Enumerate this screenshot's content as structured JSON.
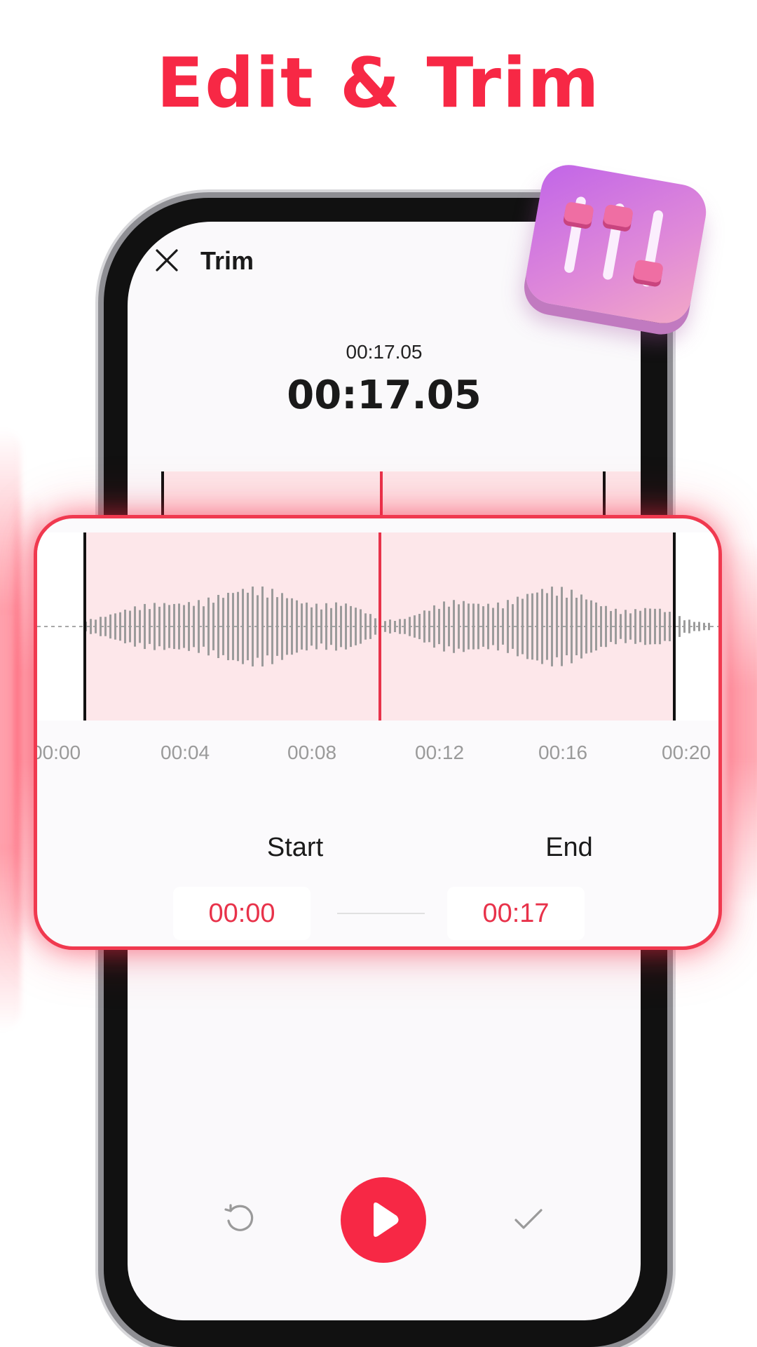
{
  "headline": "Edit & Trim",
  "screen": {
    "title": "Trim",
    "current_time_small": "00:17.05",
    "current_time_large": "00:17.05"
  },
  "timeline": {
    "ticks": [
      "00:00",
      "00:04",
      "00:08",
      "00:12",
      "00:16",
      "00:20"
    ]
  },
  "trim": {
    "start_label": "Start",
    "start_value": "00:00",
    "end_label": "End",
    "end_value": "00:17"
  },
  "icons": {
    "close": "close-icon",
    "sliders": "sliders-icon",
    "reset": "reset-icon",
    "play": "play-icon",
    "confirm": "check-icon"
  },
  "colors": {
    "accent": "#f72845",
    "selection": "#fde7ea",
    "waveform": "#9b9b9b"
  }
}
